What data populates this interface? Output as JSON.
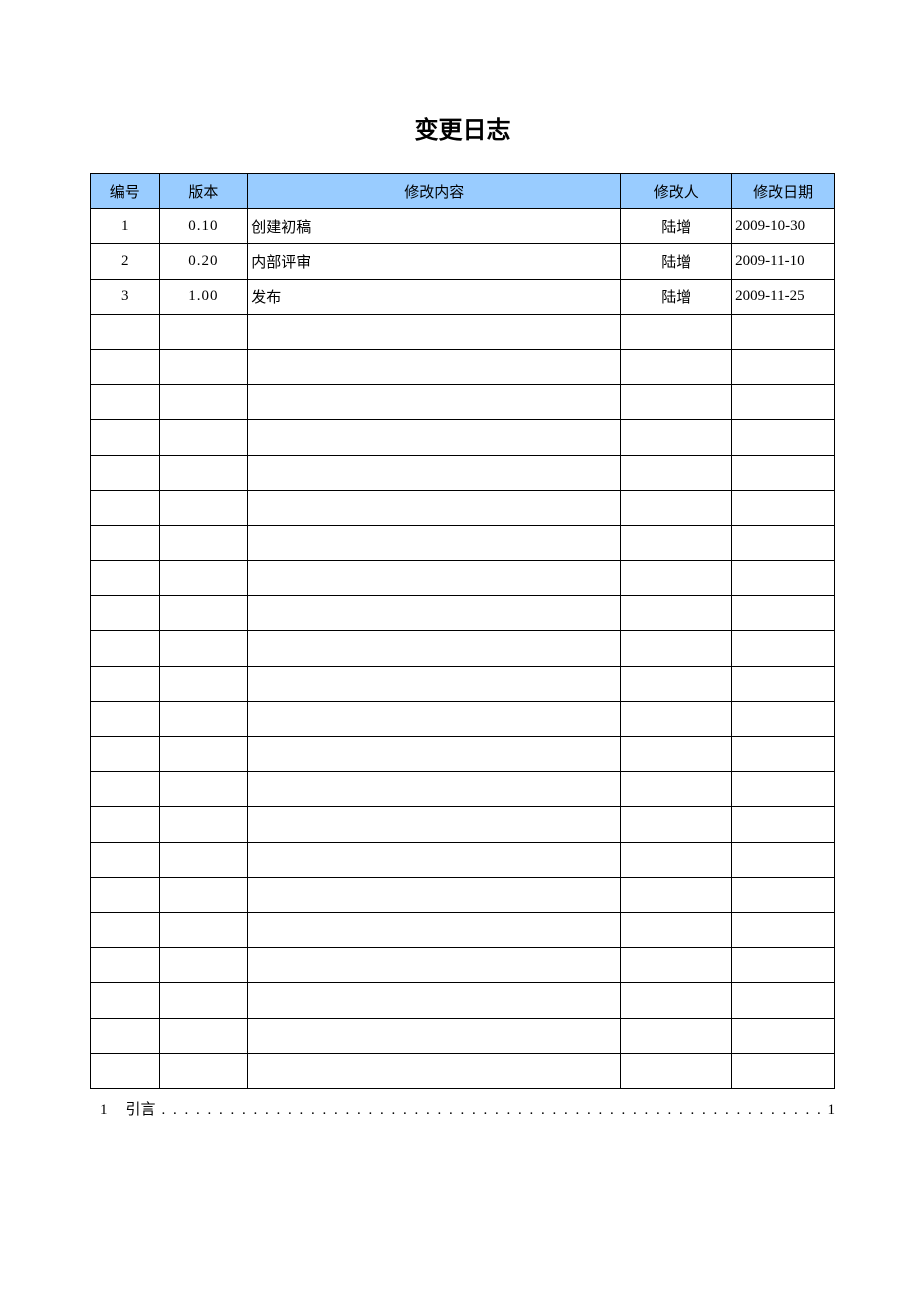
{
  "title": "变更日志",
  "headers": {
    "id": "编号",
    "version": "版本",
    "content": "修改内容",
    "author": "修改人",
    "date": "修改日期"
  },
  "rows": [
    {
      "id": "1",
      "version": "0.10",
      "content": "创建初稿",
      "author": "陆增",
      "date": "2009-10-30"
    },
    {
      "id": "2",
      "version": "0.20",
      "content": "内部评审",
      "author": "陆增",
      "date": "2009-11-10"
    },
    {
      "id": "3",
      "version": "1.00",
      "content": "发布",
      "author": "陆增",
      "date": "2009-11-25"
    },
    {
      "id": "",
      "version": "",
      "content": "",
      "author": "",
      "date": ""
    },
    {
      "id": "",
      "version": "",
      "content": "",
      "author": "",
      "date": ""
    },
    {
      "id": "",
      "version": "",
      "content": "",
      "author": "",
      "date": ""
    },
    {
      "id": "",
      "version": "",
      "content": "",
      "author": "",
      "date": ""
    },
    {
      "id": "",
      "version": "",
      "content": "",
      "author": "",
      "date": ""
    },
    {
      "id": "",
      "version": "",
      "content": "",
      "author": "",
      "date": ""
    },
    {
      "id": "",
      "version": "",
      "content": "",
      "author": "",
      "date": ""
    },
    {
      "id": "",
      "version": "",
      "content": "",
      "author": "",
      "date": ""
    },
    {
      "id": "",
      "version": "",
      "content": "",
      "author": "",
      "date": ""
    },
    {
      "id": "",
      "version": "",
      "content": "",
      "author": "",
      "date": ""
    },
    {
      "id": "",
      "version": "",
      "content": "",
      "author": "",
      "date": ""
    },
    {
      "id": "",
      "version": "",
      "content": "",
      "author": "",
      "date": ""
    },
    {
      "id": "",
      "version": "",
      "content": "",
      "author": "",
      "date": ""
    },
    {
      "id": "",
      "version": "",
      "content": "",
      "author": "",
      "date": ""
    },
    {
      "id": "",
      "version": "",
      "content": "",
      "author": "",
      "date": ""
    },
    {
      "id": "",
      "version": "",
      "content": "",
      "author": "",
      "date": ""
    },
    {
      "id": "",
      "version": "",
      "content": "",
      "author": "",
      "date": ""
    },
    {
      "id": "",
      "version": "",
      "content": "",
      "author": "",
      "date": ""
    },
    {
      "id": "",
      "version": "",
      "content": "",
      "author": "",
      "date": ""
    },
    {
      "id": "",
      "version": "",
      "content": "",
      "author": "",
      "date": ""
    },
    {
      "id": "",
      "version": "",
      "content": "",
      "author": "",
      "date": ""
    },
    {
      "id": "",
      "version": "",
      "content": "",
      "author": "",
      "date": ""
    }
  ],
  "toc": {
    "num": "1",
    "text": "引言",
    "dots": ". . . . . . . . . . . . . . . . . . . . . . . . . . . . . . . . . . . . . . . . . . . . . . . . . . . . . . . . . . . . . . . . . . . . . .",
    "page": "1"
  }
}
